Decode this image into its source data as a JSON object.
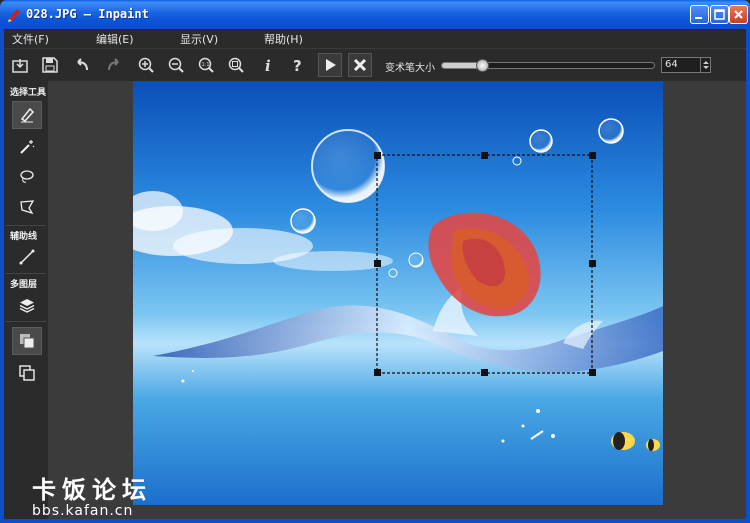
{
  "window": {
    "title": "028.JPG — Inpaint"
  },
  "menu": {
    "items": [
      "文件(F)",
      "编辑(E)",
      "显示(V)",
      "帮助(H)"
    ]
  },
  "toolbar": {
    "brush_size_label": "变术笔大小",
    "brush_size_value": "64",
    "brush_size_fraction": 0.17,
    "buttons": [
      "open-icon",
      "save-icon",
      "undo-icon",
      "redo-icon",
      "zoom-in-icon",
      "zoom-out-icon",
      "actual-size-icon",
      "fit-window-icon",
      "info-icon",
      "help-icon",
      "run-icon",
      "cancel-icon"
    ]
  },
  "tools": {
    "select_label": "选择工具",
    "guide_label": "辅助线",
    "layers_label": "多图层"
  },
  "watermark": {
    "title": "卡饭论坛",
    "url": "bbs.kafan.cn"
  },
  "colors": {
    "titlebar": "#0b4fcf",
    "panel": "#2b2b2b",
    "selection_red": "#e04040"
  }
}
